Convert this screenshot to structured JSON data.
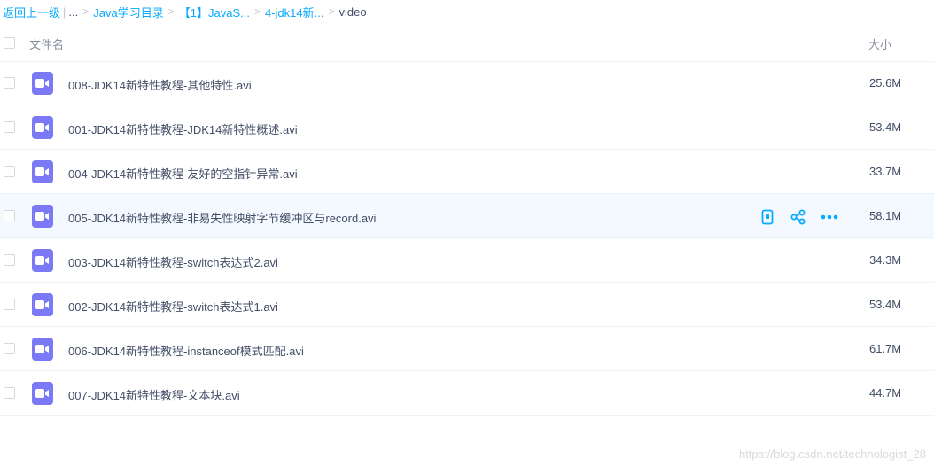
{
  "breadcrumb": {
    "back": "返回上一级",
    "pipe": "|",
    "ellipsis": "...",
    "items": [
      "Java学习目录",
      "【1】JavaS...",
      "4-jdk14新..."
    ],
    "current": "video",
    "separator": ">"
  },
  "header": {
    "name_col": "文件名",
    "size_col": "大小"
  },
  "files": [
    {
      "name": "008-JDK14新特性教程-其他特性.avi",
      "size": "25.6M",
      "icon": "video-icon"
    },
    {
      "name": "001-JDK14新特性教程-JDK14新特性概述.avi",
      "size": "53.4M",
      "icon": "video-icon"
    },
    {
      "name": "004-JDK14新特性教程-友好的空指针异常.avi",
      "size": "33.7M",
      "icon": "video-icon"
    },
    {
      "name": "005-JDK14新特性教程-非易失性映射字节缓冲区与record.avi",
      "size": "58.1M",
      "icon": "video-icon",
      "hovered": true
    },
    {
      "name": "003-JDK14新特性教程-switch表达式2.avi",
      "size": "34.3M",
      "icon": "video-icon"
    },
    {
      "name": "002-JDK14新特性教程-switch表达式1.avi",
      "size": "53.4M",
      "icon": "video-icon"
    },
    {
      "name": "006-JDK14新特性教程-instanceof模式匹配.avi",
      "size": "61.7M",
      "icon": "video-icon"
    },
    {
      "name": "007-JDK14新特性教程-文本块.avi",
      "size": "44.7M",
      "icon": "video-icon"
    }
  ],
  "row_actions": [
    "phone-icon",
    "share-icon",
    "more-icon"
  ],
  "colors": {
    "link": "#09aaff",
    "icon_bg": "#7b79f5",
    "hover_bg": "#f3f9fe",
    "action": "#09aaff"
  },
  "watermark": "https://blog.csdn.net/technologist_28"
}
